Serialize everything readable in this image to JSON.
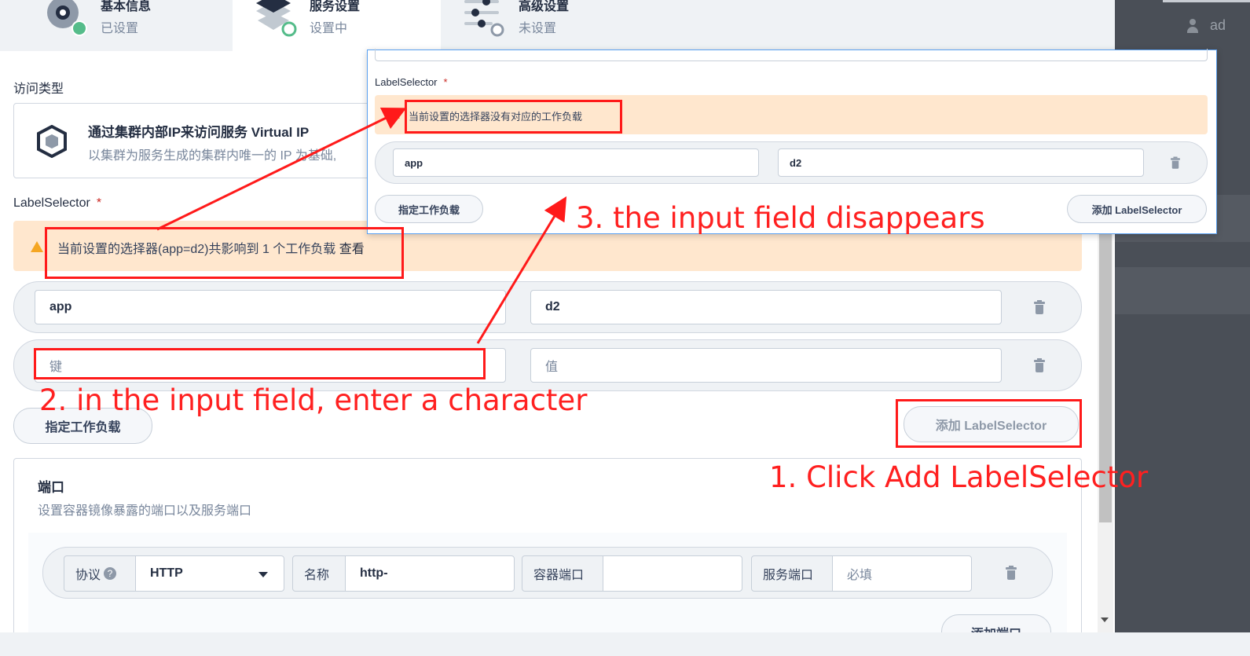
{
  "steps": [
    {
      "title": "基本信息",
      "status": "已设置"
    },
    {
      "title": "服务设置",
      "status": "设置中"
    },
    {
      "title": "高级设置",
      "status": "未设置"
    }
  ],
  "access": {
    "label": "访问类型",
    "card_title": "通过集群内部IP来访问服务 Virtual IP",
    "card_desc": "以集群为服务生成的集群内唯一的 IP 为基础,"
  },
  "label_selector": {
    "label": "LabelSelector",
    "required": "*",
    "warning": "当前设置的选择器(app=d2)共影响到 1 个工作负载",
    "warning_link": "查看",
    "rows": [
      {
        "key": "app",
        "value": "d2"
      },
      {
        "key_placeholder": "键",
        "value_placeholder": "值"
      }
    ],
    "assign_workload_button": "指定工作负载",
    "add_button": "添加 LabelSelector"
  },
  "popup": {
    "label": "LabelSelector",
    "required": "*",
    "warning": "当前设置的选择器没有对应的工作负载",
    "row": {
      "key": "app",
      "value": "d2"
    },
    "assign_workload_button": "指定工作负载",
    "add_button": "添加 LabelSelector"
  },
  "ports": {
    "title": "端口",
    "desc": "设置容器镜像暴露的端口以及服务端口",
    "protocol_label": "协议",
    "protocol_help": "?",
    "protocol_value": "HTTP",
    "name_label": "名称",
    "name_value": "http-",
    "container_port_label": "容器端口",
    "container_port_value": "",
    "service_port_label": "服务端口",
    "service_port_placeholder": "必填",
    "add_port_button": "添加端口"
  },
  "user": {
    "name": "ad"
  },
  "annotations": {
    "step1": "1. Click Add LabelSelector",
    "step2": "2. in the input field, enter a character",
    "step3": "3. the input field disappears"
  },
  "colors": {
    "annotation": "#ff1a1a",
    "warning_bg": "#ffe7ce",
    "success": "#55bc8a"
  }
}
